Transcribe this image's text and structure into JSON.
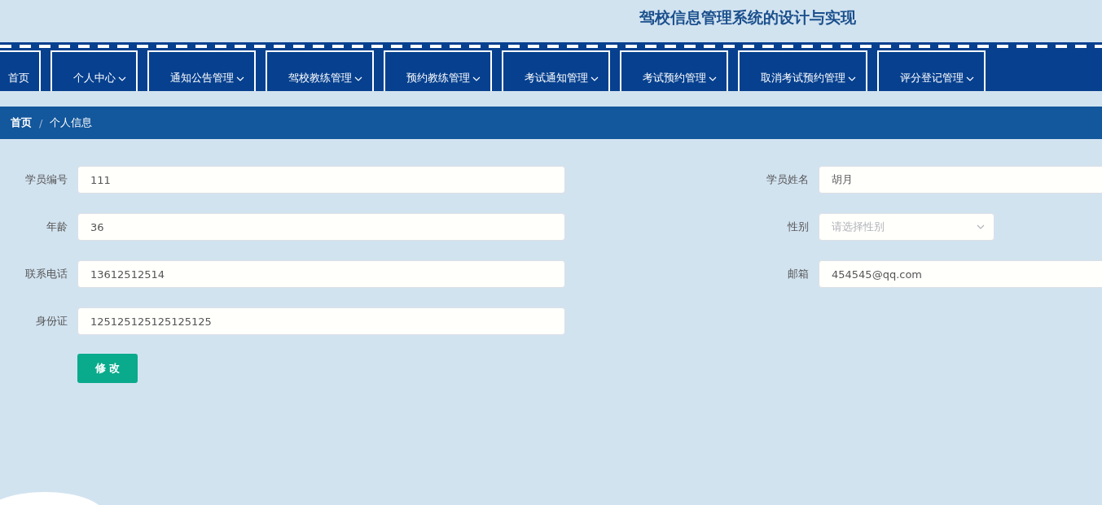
{
  "header": {
    "title": "驾校信息管理系统的设计与实现"
  },
  "nav": [
    {
      "label": "首页",
      "dropdown": false
    },
    {
      "label": "个人中心",
      "dropdown": true
    },
    {
      "label": "通知公告管理",
      "dropdown": true
    },
    {
      "label": "驾校教练管理",
      "dropdown": true
    },
    {
      "label": "预约教练管理",
      "dropdown": true
    },
    {
      "label": "考试通知管理",
      "dropdown": true
    },
    {
      "label": "考试预约管理",
      "dropdown": true
    },
    {
      "label": "取消考试预约管理",
      "dropdown": true
    },
    {
      "label": "评分登记管理",
      "dropdown": true
    }
  ],
  "breadcrumb": {
    "items": [
      "首页",
      "个人信息"
    ],
    "separator": "/"
  },
  "form": {
    "left": [
      {
        "label": "学员编号",
        "value": "111"
      },
      {
        "label": "年龄",
        "value": "36"
      },
      {
        "label": "联系电话",
        "value": "13612512514"
      },
      {
        "label": "身份证",
        "value": "125125125125125125"
      }
    ],
    "right": [
      {
        "label": "学员姓名",
        "kind": "text",
        "value": "胡月"
      },
      {
        "label": "性别",
        "kind": "select",
        "placeholder": "请选择性别"
      },
      {
        "label": "邮箱",
        "kind": "text",
        "value": "454545@qq.com"
      }
    ],
    "submit": "修 改"
  }
}
